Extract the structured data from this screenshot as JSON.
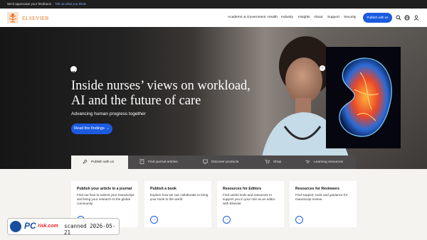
{
  "feedback_bar": {
    "message": "We'd appreciate your feedback.",
    "link": "Tell us what you think!"
  },
  "header": {
    "brand": "ELSEVIER",
    "nav": [
      "Academic & Government",
      "Health",
      "Industry",
      "Insights",
      "About",
      "Support",
      "Security"
    ],
    "publish_label": "Publish with us",
    "icons": [
      "search-icon",
      "globe-icon",
      "user-icon"
    ]
  },
  "hero": {
    "title": "Inside nurses’ views on workload, AI and the future of care",
    "subtitle": "Advancing human progress together",
    "cta_label": "Read the findings →",
    "slider": {
      "prev": "‹",
      "next": "›",
      "slides": 4,
      "active_slide": 1
    }
  },
  "tabs": [
    {
      "label": "Publish with us",
      "icon": "publish-icon",
      "active": true
    },
    {
      "label": "Find journal articles",
      "icon": "journal-icon",
      "active": false
    },
    {
      "label": "Discover products",
      "icon": "monitor-icon",
      "active": false
    },
    {
      "label": "Shop",
      "icon": "cart-icon",
      "active": false
    },
    {
      "label": "Learning resources",
      "icon": "handshake-icon",
      "active": false
    }
  ],
  "cards": [
    {
      "title": "Publish your article in a journal",
      "body": "Find out how to submit your manuscript and bring your research to the global community.",
      "arrow": "→"
    },
    {
      "title": "Publish a book",
      "body": "Explore how we can collaborate to bring your book to the world.",
      "arrow": "→"
    },
    {
      "title": "Resources for Editors",
      "body": "Find useful tools and resources to support you in your role as an editor with Elsevier.",
      "arrow": "→"
    },
    {
      "title": "Resources for Reviewers",
      "body": "Find support, tools and guidance for manuscript review.",
      "arrow": "→"
    }
  ],
  "watermark": {
    "pc": "PC",
    "risk": "risk.com",
    "stamp": "scanned 2026-05-21"
  },
  "colors": {
    "brand": "#e9711c",
    "accent": "#1b5be0",
    "tabbar": "#4c4a4a",
    "background": "#f5f3ef"
  }
}
